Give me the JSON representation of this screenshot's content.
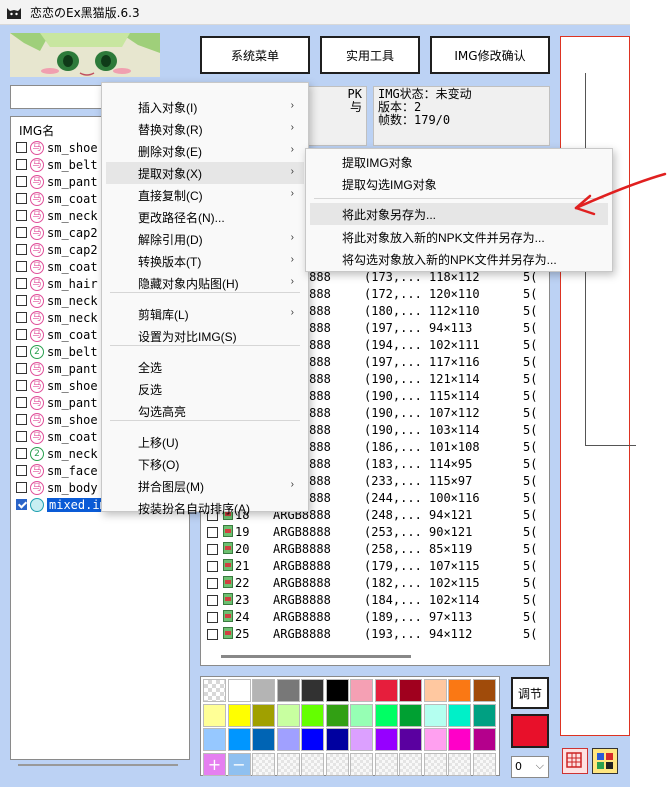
{
  "window": {
    "title": "恋恋のEx黑猫版.6.3"
  },
  "toolbar": {
    "system_menu": "系统菜单",
    "tools": "实用工具",
    "img_confirm": "IMG修改确认"
  },
  "npk_info": {
    "line1": "PK",
    "line2": "与"
  },
  "img_status": {
    "line1": "IMG状态：未变动",
    "line2": "版本：2",
    "line3": "帧数：179/0"
  },
  "img_list": {
    "header": "IMG名",
    "items": [
      {
        "name": "sm_shoe",
        "badge": "马",
        "badge_color": "#e0509a",
        "checked": false
      },
      {
        "name": "sm_belt",
        "badge": "马",
        "badge_color": "#e0509a",
        "checked": false
      },
      {
        "name": "sm_pant",
        "badge": "马",
        "badge_color": "#e0509a",
        "checked": false
      },
      {
        "name": "sm_coat",
        "badge": "马",
        "badge_color": "#e0509a",
        "checked": false
      },
      {
        "name": "sm_neck",
        "badge": "马",
        "badge_color": "#e0509a",
        "checked": false
      },
      {
        "name": "sm_cap2",
        "badge": "马",
        "badge_color": "#e0509a",
        "checked": false
      },
      {
        "name": "sm_cap2",
        "badge": "马",
        "badge_color": "#e0509a",
        "checked": false
      },
      {
        "name": "sm_coat",
        "badge": "马",
        "badge_color": "#e0509a",
        "checked": false
      },
      {
        "name": "sm_hair",
        "badge": "马",
        "badge_color": "#e0509a",
        "checked": false
      },
      {
        "name": "sm_neck",
        "badge": "马",
        "badge_color": "#e0509a",
        "checked": false
      },
      {
        "name": "sm_neck",
        "badge": "马",
        "badge_color": "#e0509a",
        "checked": false
      },
      {
        "name": "sm_coat",
        "badge": "马",
        "badge_color": "#e0509a",
        "checked": false
      },
      {
        "name": "sm_belt",
        "badge": "2",
        "badge_color": "#2aa050",
        "checked": false
      },
      {
        "name": "sm_pant",
        "badge": "马",
        "badge_color": "#e0509a",
        "checked": false
      },
      {
        "name": "sm_shoe",
        "badge": "马",
        "badge_color": "#e0509a",
        "checked": false
      },
      {
        "name": "sm_pant",
        "badge": "马",
        "badge_color": "#e0509a",
        "checked": false
      },
      {
        "name": "sm_shoe",
        "badge": "马",
        "badge_color": "#e0509a",
        "checked": false
      },
      {
        "name": "sm_coat",
        "badge": "马",
        "badge_color": "#e0509a",
        "checked": false
      },
      {
        "name": "sm_neck",
        "badge": "2",
        "badge_color": "#2aa050",
        "checked": false
      },
      {
        "name": "sm_face",
        "badge": "马",
        "badge_color": "#e0509a",
        "checked": false
      },
      {
        "name": "sm_body",
        "badge": "马",
        "badge_color": "#e0509a",
        "checked": false
      },
      {
        "name": "mixed.img",
        "badge": "",
        "badge_color": "#20a0b0",
        "checked": true,
        "selected": true
      }
    ]
  },
  "frames": [
    {
      "idx": "",
      "fmt": "ARGB8888",
      "pos": "(173,...",
      "size": "118×112",
      "extra": "5("
    },
    {
      "idx": "",
      "fmt": "ARGB8888",
      "pos": "(172,...",
      "size": "120×110",
      "extra": "5("
    },
    {
      "idx": "",
      "fmt": "ARGB8888",
      "pos": "(180,...",
      "size": "112×110",
      "extra": "5("
    },
    {
      "idx": "",
      "fmt": "ARGB8888",
      "pos": "(197,...",
      "size": "94×113",
      "extra": "5("
    },
    {
      "idx": "",
      "fmt": "ARGB8888",
      "pos": "(194,...",
      "size": "102×111",
      "extra": "5("
    },
    {
      "idx": "",
      "fmt": "ARGB8888",
      "pos": "(197,...",
      "size": "117×116",
      "extra": "5("
    },
    {
      "idx": "",
      "fmt": "ARGB8888",
      "pos": "(190,...",
      "size": "121×114",
      "extra": "5("
    },
    {
      "idx": "",
      "fmt": "ARGB8888",
      "pos": "(190,...",
      "size": "115×114",
      "extra": "5("
    },
    {
      "idx": "",
      "fmt": "ARGB8888",
      "pos": "(190,...",
      "size": "107×112",
      "extra": "5("
    },
    {
      "idx": "",
      "fmt": "ARGB8888",
      "pos": "(190,...",
      "size": "103×114",
      "extra": "5("
    },
    {
      "idx": "",
      "fmt": "ARGB8888",
      "pos": "(186,...",
      "size": "101×108",
      "extra": "5("
    },
    {
      "idx": "",
      "fmt": "ARGB8888",
      "pos": "(183,...",
      "size": "114×95",
      "extra": "5("
    },
    {
      "idx": "",
      "fmt": "ARGB8888",
      "pos": "(233,...",
      "size": "115×97",
      "extra": "5("
    },
    {
      "idx": "",
      "fmt": "ARGB8888",
      "pos": "(244,...",
      "size": "100×116",
      "extra": "5("
    },
    {
      "idx": "18",
      "fmt": "ARGB8888",
      "pos": "(248,...",
      "size": "94×121",
      "extra": "5("
    },
    {
      "idx": "19",
      "fmt": "ARGB8888",
      "pos": "(253,...",
      "size": "90×121",
      "extra": "5("
    },
    {
      "idx": "20",
      "fmt": "ARGB8888",
      "pos": "(258,...",
      "size": "85×119",
      "extra": "5("
    },
    {
      "idx": "21",
      "fmt": "ARGB8888",
      "pos": "(179,...",
      "size": "107×115",
      "extra": "5("
    },
    {
      "idx": "22",
      "fmt": "ARGB8888",
      "pos": "(182,...",
      "size": "102×115",
      "extra": "5("
    },
    {
      "idx": "23",
      "fmt": "ARGB8888",
      "pos": "(184,...",
      "size": "102×114",
      "extra": "5("
    },
    {
      "idx": "24",
      "fmt": "ARGB8888",
      "pos": "(189,...",
      "size": "97×113",
      "extra": "5("
    },
    {
      "idx": "25",
      "fmt": "ARGB8888",
      "pos": "(193,...",
      "size": "94×112",
      "extra": "5("
    }
  ],
  "palette": {
    "row1": [
      "checker",
      "#ffffff",
      "#b4b4b4",
      "#787878",
      "#323232",
      "#000000",
      "#f5a0b4",
      "#e61e3c",
      "#a0001e",
      "#ffc8a0",
      "#fa7814",
      "#a04b0a"
    ],
    "row2": [
      "#ffff96",
      "#ffff00",
      "#a0a000",
      "#c8ffa0",
      "#64ff00",
      "#32a014",
      "#96ffb4",
      "#00ff64",
      "#00a032",
      "#b4fff0",
      "#00f0c8",
      "#00a082"
    ],
    "row3": [
      "#96c8ff",
      "#0096ff",
      "#0064b4",
      "#a0a0ff",
      "#0000ff",
      "#0000a0",
      "#dca0ff",
      "#9600ff",
      "#5a00a0",
      "#ffa0f0",
      "#ff00c8",
      "#b4008c"
    ],
    "add_label": "+",
    "remove_label": "−"
  },
  "right_controls": {
    "adjust": "调节",
    "current_color": "#e8102a",
    "select_value": "0"
  },
  "context_menu": {
    "items": [
      {
        "label": "插入对象(I)",
        "submenu": true
      },
      {
        "label": "替换对象(R)",
        "submenu": true
      },
      {
        "label": "删除对象(E)",
        "submenu": true
      },
      {
        "label": "提取对象(X)",
        "submenu": true,
        "highlighted": true
      },
      {
        "label": "直接复制(C)",
        "submenu": true
      },
      {
        "label": "更改路径名(N)...",
        "submenu": false
      },
      {
        "label": "解除引用(D)",
        "submenu": true
      },
      {
        "label": "转换版本(T)",
        "submenu": true
      },
      {
        "label": "隐藏对象内贴图(H)",
        "submenu": true
      },
      {
        "label": "剪辑库(L)",
        "submenu": true
      },
      {
        "label": "设置为对比IMG(S)",
        "submenu": false
      },
      {
        "label": "全选",
        "submenu": false
      },
      {
        "label": "反选",
        "submenu": false
      },
      {
        "label": "勾选高亮",
        "submenu": false
      },
      {
        "label": "上移(U)",
        "submenu": false
      },
      {
        "label": "下移(O)",
        "submenu": false
      },
      {
        "label": "拼合图层(M)",
        "submenu": true
      },
      {
        "label": "按装扮名自动排序(A)",
        "submenu": false
      }
    ]
  },
  "submenu": {
    "items": [
      {
        "label": "提取IMG对象"
      },
      {
        "label": "提取勾选IMG对象"
      },
      {
        "label": "将此对象另存为...",
        "highlighted": true
      },
      {
        "label": "将此对象放入新的NPK文件并另存为..."
      },
      {
        "label": "将勾选对象放入新的NPK文件并另存为..."
      }
    ]
  },
  "icons": {
    "submenu_arrow": "›",
    "dropdown_arrow": "⌵"
  }
}
